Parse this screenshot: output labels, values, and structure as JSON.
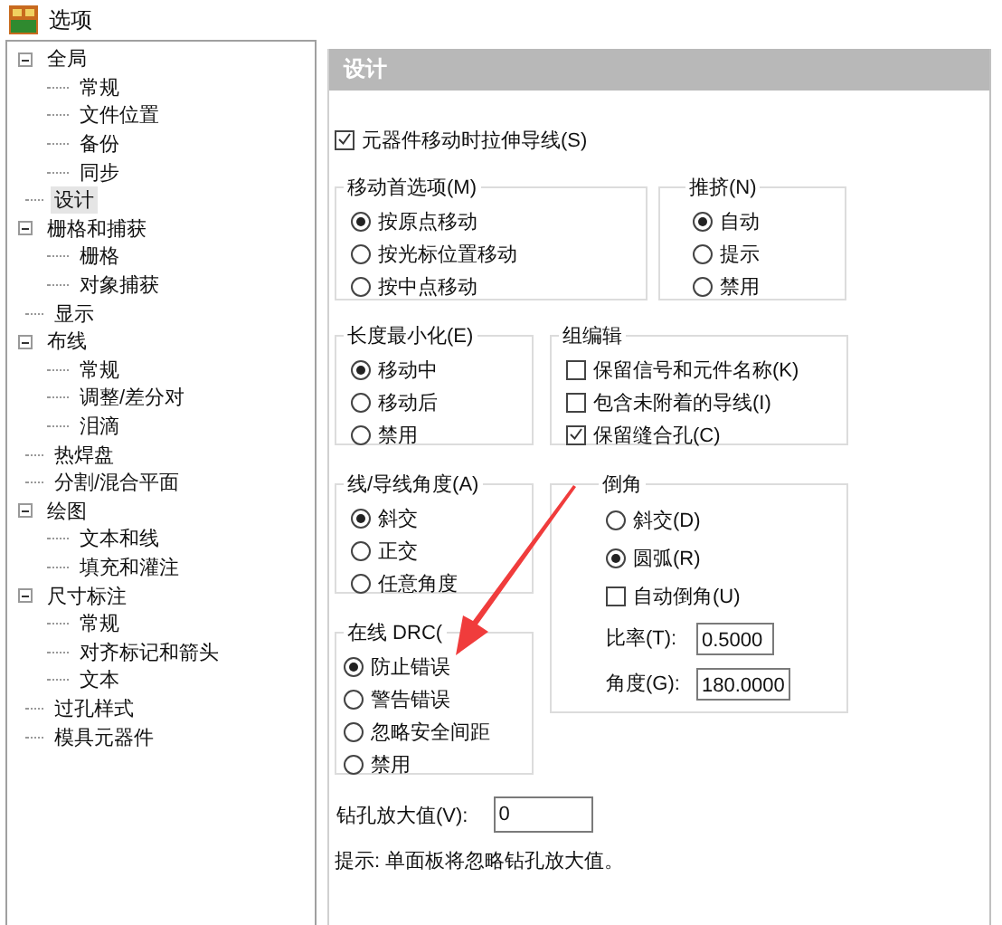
{
  "window": {
    "title": "选项"
  },
  "tree": [
    {
      "label": "全局",
      "expanded": true,
      "selected": false,
      "children": [
        {
          "label": "常规",
          "selected": false
        },
        {
          "label": "文件位置",
          "selected": false
        },
        {
          "label": "备份",
          "selected": false
        },
        {
          "label": "同步",
          "selected": false
        }
      ]
    },
    {
      "label": "设计",
      "selected": true
    },
    {
      "label": "栅格和捕获",
      "expanded": true,
      "selected": false,
      "children": [
        {
          "label": "栅格",
          "selected": false
        },
        {
          "label": "对象捕获",
          "selected": false
        }
      ]
    },
    {
      "label": "显示",
      "selected": false
    },
    {
      "label": "布线",
      "expanded": true,
      "selected": false,
      "children": [
        {
          "label": "常规",
          "selected": false
        },
        {
          "label": "调整/差分对",
          "selected": false
        },
        {
          "label": "泪滴",
          "selected": false
        }
      ]
    },
    {
      "label": "热焊盘",
      "selected": false
    },
    {
      "label": "分割/混合平面",
      "selected": false
    },
    {
      "label": "绘图",
      "expanded": true,
      "selected": false,
      "children": [
        {
          "label": "文本和线",
          "selected": false
        },
        {
          "label": "填充和灌注",
          "selected": false
        }
      ]
    },
    {
      "label": "尺寸标注",
      "expanded": true,
      "selected": false,
      "children": [
        {
          "label": "常规",
          "selected": false
        },
        {
          "label": "对齐标记和箭头",
          "selected": false
        },
        {
          "label": "文本",
          "selected": false
        }
      ]
    },
    {
      "label": "过孔样式",
      "selected": false
    },
    {
      "label": "模具元器件",
      "selected": false
    }
  ],
  "panel": {
    "title": "设计"
  },
  "stretch_traces": {
    "label": "元器件移动时拉伸导线(S)",
    "checked": true
  },
  "move_preference": {
    "title": "移动首选项(M)",
    "options": [
      {
        "label": "按原点移动",
        "selected": true
      },
      {
        "label": "按光标位置移动",
        "selected": false
      },
      {
        "label": "按中点移动",
        "selected": false
      }
    ]
  },
  "push": {
    "title": "推挤(N)",
    "options": [
      {
        "label": "自动",
        "selected": true
      },
      {
        "label": "提示",
        "selected": false
      },
      {
        "label": "禁用",
        "selected": false
      }
    ]
  },
  "length_minimize": {
    "title": "长度最小化(E)",
    "options": [
      {
        "label": "移动中",
        "selected": true
      },
      {
        "label": "移动后",
        "selected": false
      },
      {
        "label": "禁用",
        "selected": false
      }
    ]
  },
  "group_edit": {
    "title": "组编辑",
    "options": [
      {
        "label": "保留信号和元件名称(K)",
        "checked": false
      },
      {
        "label": "包含未附着的导线(I)",
        "checked": false
      },
      {
        "label": "保留缝合孔(C)",
        "checked": true
      }
    ]
  },
  "trace_angle": {
    "title": "线/导线角度(A)",
    "options": [
      {
        "label": "斜交",
        "selected": true
      },
      {
        "label": "正交",
        "selected": false
      },
      {
        "label": "任意角度",
        "selected": false
      }
    ]
  },
  "miter": {
    "title": "倒角",
    "options": [
      {
        "label": "斜交(D)",
        "selected": false
      },
      {
        "label": "圆弧(R)",
        "selected": true
      }
    ],
    "auto_miter": {
      "label": "自动倒角(U)",
      "checked": false
    },
    "ratio": {
      "label": "比率(T):",
      "value": "0.5000"
    },
    "angle": {
      "label": "角度(G):",
      "value": "180.0000"
    }
  },
  "online_drc": {
    "title": "在线 DRC(",
    "options": [
      {
        "label": "防止错误",
        "selected": true
      },
      {
        "label": "警告错误",
        "selected": false
      },
      {
        "label": "忽略安全间距",
        "selected": false
      },
      {
        "label": "禁用",
        "selected": false
      }
    ]
  },
  "drill_oversize": {
    "label": "钻孔放大值(V):",
    "value": "0"
  },
  "hint": "提示:  单面板将忽略钻孔放大值。"
}
